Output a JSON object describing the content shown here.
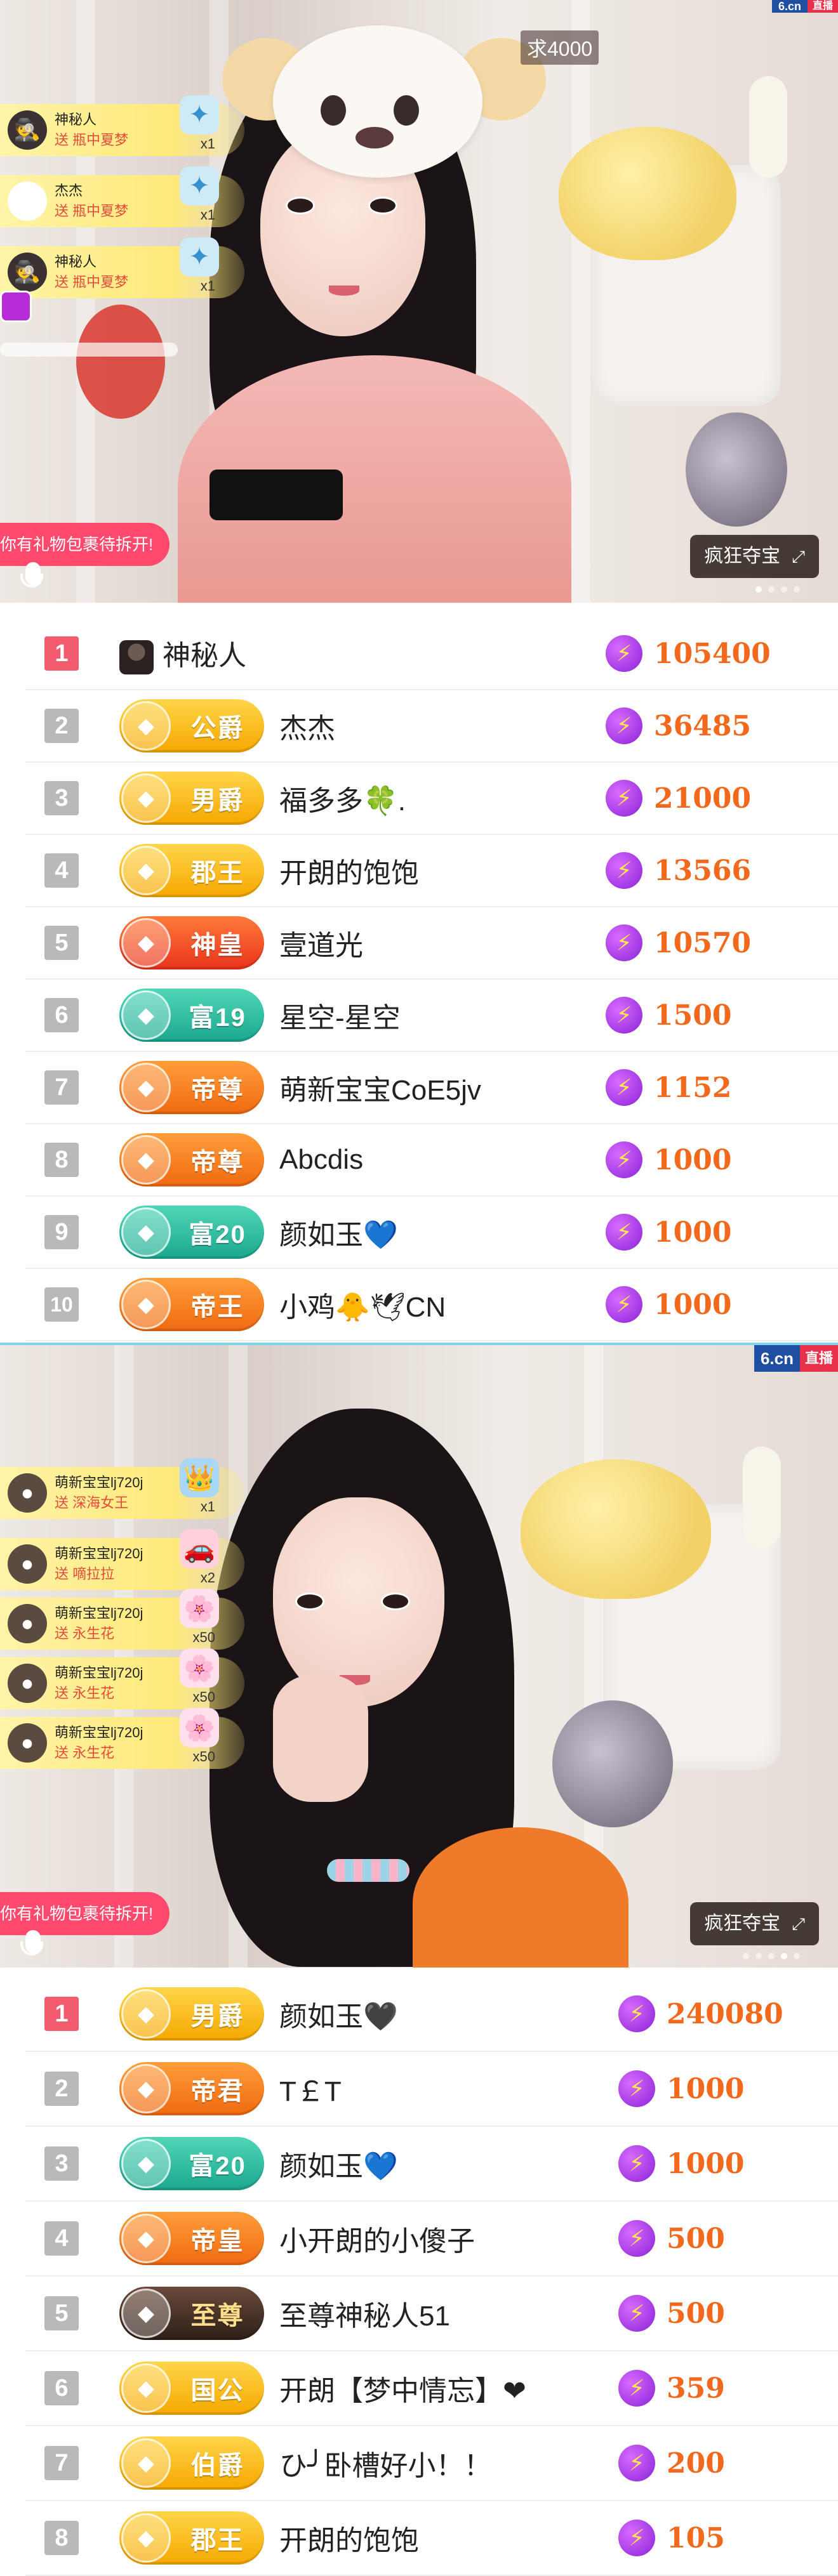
{
  "stream1": {
    "brand": {
      "logo": "6.cn",
      "live": "直播"
    },
    "request_tag": "求4000",
    "gifts": [
      {
        "user": "神秘人",
        "send": "送",
        "item": "瓶中夏梦",
        "count": "x1",
        "avatar_icon": "spy-avatar-icon",
        "avatar_glyph": "🕵"
      },
      {
        "user": "杰杰",
        "send": "送",
        "item": "瓶中夏梦",
        "count": "x1",
        "avatar_icon": "red-face-avatar-icon",
        "avatar_glyph": "😊"
      },
      {
        "user": "神秘人",
        "send": "送",
        "item": "瓶中夏梦",
        "count": "x1",
        "avatar_icon": "spy-avatar-icon",
        "avatar_glyph": "🕵"
      }
    ],
    "banner": "你有礼物包裹待拆开!",
    "treasure_button": "疯狂夺宝",
    "expand_glyph": "⤢"
  },
  "ranking1": [
    {
      "rank": "1",
      "badge": null,
      "name": "神秘人",
      "score": "105400",
      "name_icon": "spy-avatar-icon"
    },
    {
      "rank": "2",
      "badge": "公爵",
      "badge_style": "gold",
      "name": "杰杰",
      "score": "36485"
    },
    {
      "rank": "3",
      "badge": "男爵",
      "badge_style": "gold",
      "name": "福多多🍀.",
      "score": "21000"
    },
    {
      "rank": "4",
      "badge": "郡王",
      "badge_style": "gold",
      "name": "开朗的饱饱",
      "score": "13566"
    },
    {
      "rank": "5",
      "badge": "神皇",
      "badge_style": "red",
      "name": "壹道光",
      "score": "10570"
    },
    {
      "rank": "6",
      "badge": "富19",
      "badge_style": "teal",
      "name": "星空-星空",
      "score": "1500"
    },
    {
      "rank": "7",
      "badge": "帝尊",
      "badge_style": "orange",
      "name": "萌新宝宝CoE5jv",
      "score": "1152"
    },
    {
      "rank": "8",
      "badge": "帝尊",
      "badge_style": "orange",
      "name": "Abcdis",
      "score": "1000"
    },
    {
      "rank": "9",
      "badge": "富20",
      "badge_style": "teal",
      "name": "颜如玉💙",
      "score": "1000"
    },
    {
      "rank": "10",
      "badge": "帝王",
      "badge_style": "orange",
      "name": "小鸡🐥🕊CN",
      "score": "1000"
    }
  ],
  "stream2": {
    "brand": {
      "logo": "6.cn",
      "live": "直播"
    },
    "gifts": [
      {
        "user": "萌新宝宝lj720j",
        "send": "送",
        "item": "深海女王",
        "count": "x1",
        "gift_glyph": "👑"
      },
      {
        "user": "萌新宝宝lj720j",
        "send": "送",
        "item": "嘀拉拉",
        "count": "x2",
        "gift_glyph": "🚗"
      },
      {
        "user": "萌新宝宝lj720j",
        "send": "送",
        "item": "永生花",
        "count": "x50",
        "gift_glyph": "🌸"
      },
      {
        "user": "萌新宝宝lj720j",
        "send": "送",
        "item": "永生花",
        "count": "x50",
        "gift_glyph": "🌸"
      },
      {
        "user": "萌新宝宝lj720j",
        "send": "送",
        "item": "永生花",
        "count": "x50",
        "gift_glyph": "🌸"
      }
    ],
    "banner": "你有礼物包裹待拆开!",
    "treasure_button": "疯狂夺宝",
    "expand_glyph": "⤢"
  },
  "ranking2": [
    {
      "rank": "1",
      "badge": "男爵",
      "badge_style": "gold",
      "name": "颜如玉🖤",
      "score": "240080"
    },
    {
      "rank": "2",
      "badge": "帝君",
      "badge_style": "orange",
      "name": "T￡T",
      "score": "1000"
    },
    {
      "rank": "3",
      "badge": "富20",
      "badge_style": "teal",
      "name": "颜如玉💙",
      "score": "1000"
    },
    {
      "rank": "4",
      "badge": "帝皇",
      "badge_style": "orange",
      "name": "小开朗的小傻子",
      "score": "500"
    },
    {
      "rank": "5",
      "badge": "至尊",
      "badge_style": "dark",
      "name": "至尊神秘人51",
      "score": "500"
    },
    {
      "rank": "6",
      "badge": "国公",
      "badge_style": "gold",
      "name": "开朗【梦中情忘】❤",
      "score": "359"
    },
    {
      "rank": "7",
      "badge": "伯爵",
      "badge_style": "gold",
      "name": "ひ╯卧槽好小！！",
      "score": "200"
    },
    {
      "rank": "8",
      "badge": "郡王",
      "badge_style": "gold",
      "name": "开朗的饱饱",
      "score": "105"
    }
  ],
  "icons": {
    "bolt_glyph": "⚡",
    "badge_glyph": "◆"
  }
}
